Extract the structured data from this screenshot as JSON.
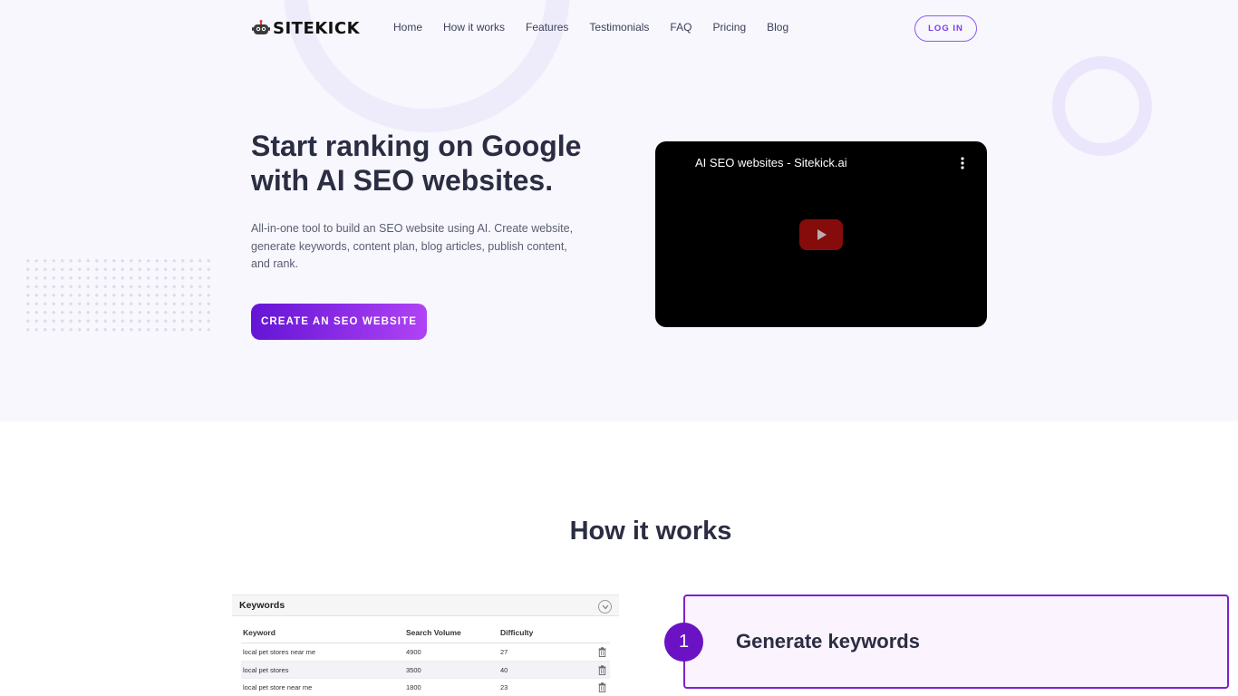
{
  "brand": {
    "logo_text": "SITEKICK",
    "accent": "#7c3aed",
    "cta_gradient": [
      "#6414d6",
      "#b043f5"
    ]
  },
  "nav": {
    "links": [
      "Home",
      "How it works",
      "Features",
      "Testimonials",
      "FAQ",
      "Pricing",
      "Blog"
    ],
    "login_label": "LOG IN"
  },
  "hero": {
    "title": "Start ranking on Google with AI SEO websites.",
    "description": "All-in-one tool to build an SEO website using AI. Create website, generate keywords, content plan, blog articles, publish content, and rank.",
    "cta_label": "CREATE AN SEO WEBSITE"
  },
  "video": {
    "title": "AI SEO websites - Sitekick.ai"
  },
  "how_it_works": {
    "title": "How it works",
    "keywords_panel": {
      "title": "Keywords",
      "columns": [
        "Keyword",
        "Search Volume",
        "Difficulty"
      ],
      "rows": [
        {
          "keyword": "local pet stores near me",
          "volume": "4900",
          "difficulty": "27"
        },
        {
          "keyword": "local pet stores",
          "volume": "3500",
          "difficulty": "40"
        },
        {
          "keyword": "local pet store near me",
          "volume": "1800",
          "difficulty": "23"
        }
      ]
    },
    "step": {
      "number": "1",
      "title": "Generate keywords"
    }
  }
}
